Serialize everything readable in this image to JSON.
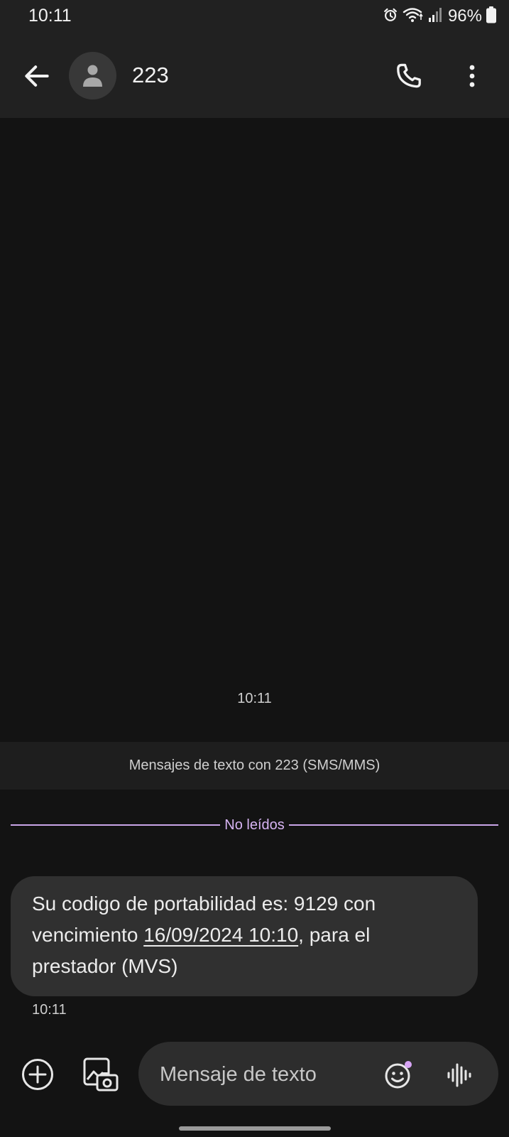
{
  "status_bar": {
    "time": "10:11",
    "battery": "96%",
    "icons": [
      "alarm-icon",
      "wifi-icon",
      "signal-icon",
      "battery-icon"
    ]
  },
  "app_bar": {
    "title": "223",
    "icons": [
      "back-arrow-icon",
      "person-icon",
      "phone-icon",
      "more-vert-icon"
    ]
  },
  "thread": {
    "time_divider": "10:11",
    "conversation_info": "Mensajes de texto con 223 (SMS/MMS)",
    "unread_label": "No leídos",
    "message": {
      "text_before_link": "Su codigo de portabilidad es: 9129 con vencimiento ",
      "link_text": "16/09/2024 10:10",
      "text_after_link": ", para el prestador (MVS)",
      "time": "10:11"
    }
  },
  "compose": {
    "placeholder": "Mensaje de texto",
    "icons": [
      "add-icon",
      "gallery-camera-icon",
      "emoji-icon",
      "voice-wave-icon"
    ]
  },
  "colors": {
    "background": "#131313",
    "bar": "#212121",
    "bubble": "#303030",
    "accent": "#d7b4f3"
  }
}
